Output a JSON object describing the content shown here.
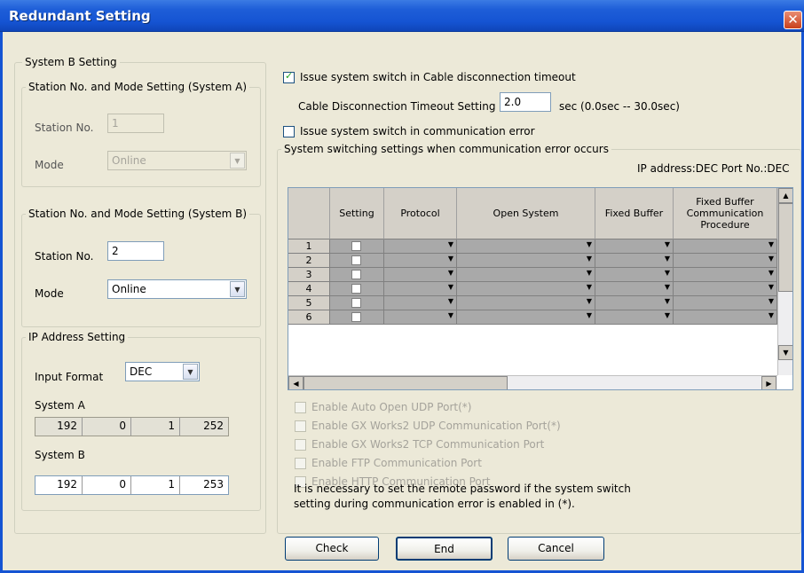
{
  "window": {
    "title": "Redundant Setting",
    "close_glyph": "✕"
  },
  "system_b_setting": {
    "legend": "System B Setting",
    "system_a_group": {
      "legend": "Station No. and Mode Setting (System A)",
      "station_label": "Station No.",
      "station_value": "1",
      "mode_label": "Mode",
      "mode_value": "Online"
    },
    "system_b_group": {
      "legend": "Station No. and Mode Setting (System B)",
      "station_label": "Station No.",
      "station_value": "2",
      "mode_label": "Mode",
      "mode_value": "Online"
    },
    "ip_group": {
      "legend": "IP Address Setting",
      "input_format_label": "Input Format",
      "input_format_value": "DEC",
      "system_a_label": "System A",
      "system_a_ip": [
        "192",
        "0",
        "1",
        "252"
      ],
      "system_b_label": "System B",
      "system_b_ip": [
        "192",
        "0",
        "1",
        "253"
      ]
    }
  },
  "right": {
    "cable_timeout_checkbox_label": "Issue system switch in Cable disconnection timeout",
    "cable_timeout_checked": true,
    "timeout_label": "Cable Disconnection Timeout Setting",
    "timeout_value": "2.0",
    "timeout_range": "sec (0.0sec -- 30.0sec)",
    "comm_error_checkbox_label": "Issue system switch in communication error",
    "comm_error_checked": false,
    "switching_group_legend": "System switching settings when communication error occurs",
    "ip_port_note": "IP address:DEC Port No.:DEC",
    "grid": {
      "headers": [
        "",
        "Setting",
        "Protocol",
        "Open System",
        "Fixed Buffer",
        "Fixed Buffer Communication Procedure"
      ],
      "rows": [
        "1",
        "2",
        "3",
        "4",
        "5",
        "6"
      ]
    },
    "disabled_options": [
      "Enable Auto Open UDP Port(*)",
      "Enable GX Works2 UDP Communication Port(*)",
      "Enable GX Works2 TCP Communication Port",
      "Enable FTP Communication Port",
      "Enable HTTP Communication Port"
    ],
    "note_line1": "It is necessary to set the remote password if the system switch",
    "note_line2": "setting during communication error is enabled in (*)."
  },
  "buttons": {
    "check": "Check",
    "end": "End",
    "cancel": "Cancel"
  },
  "colors": {
    "titlebar": "#1554d3",
    "dialog_bg": "#ece9d8",
    "grid_cell": "#a9a9a9"
  }
}
